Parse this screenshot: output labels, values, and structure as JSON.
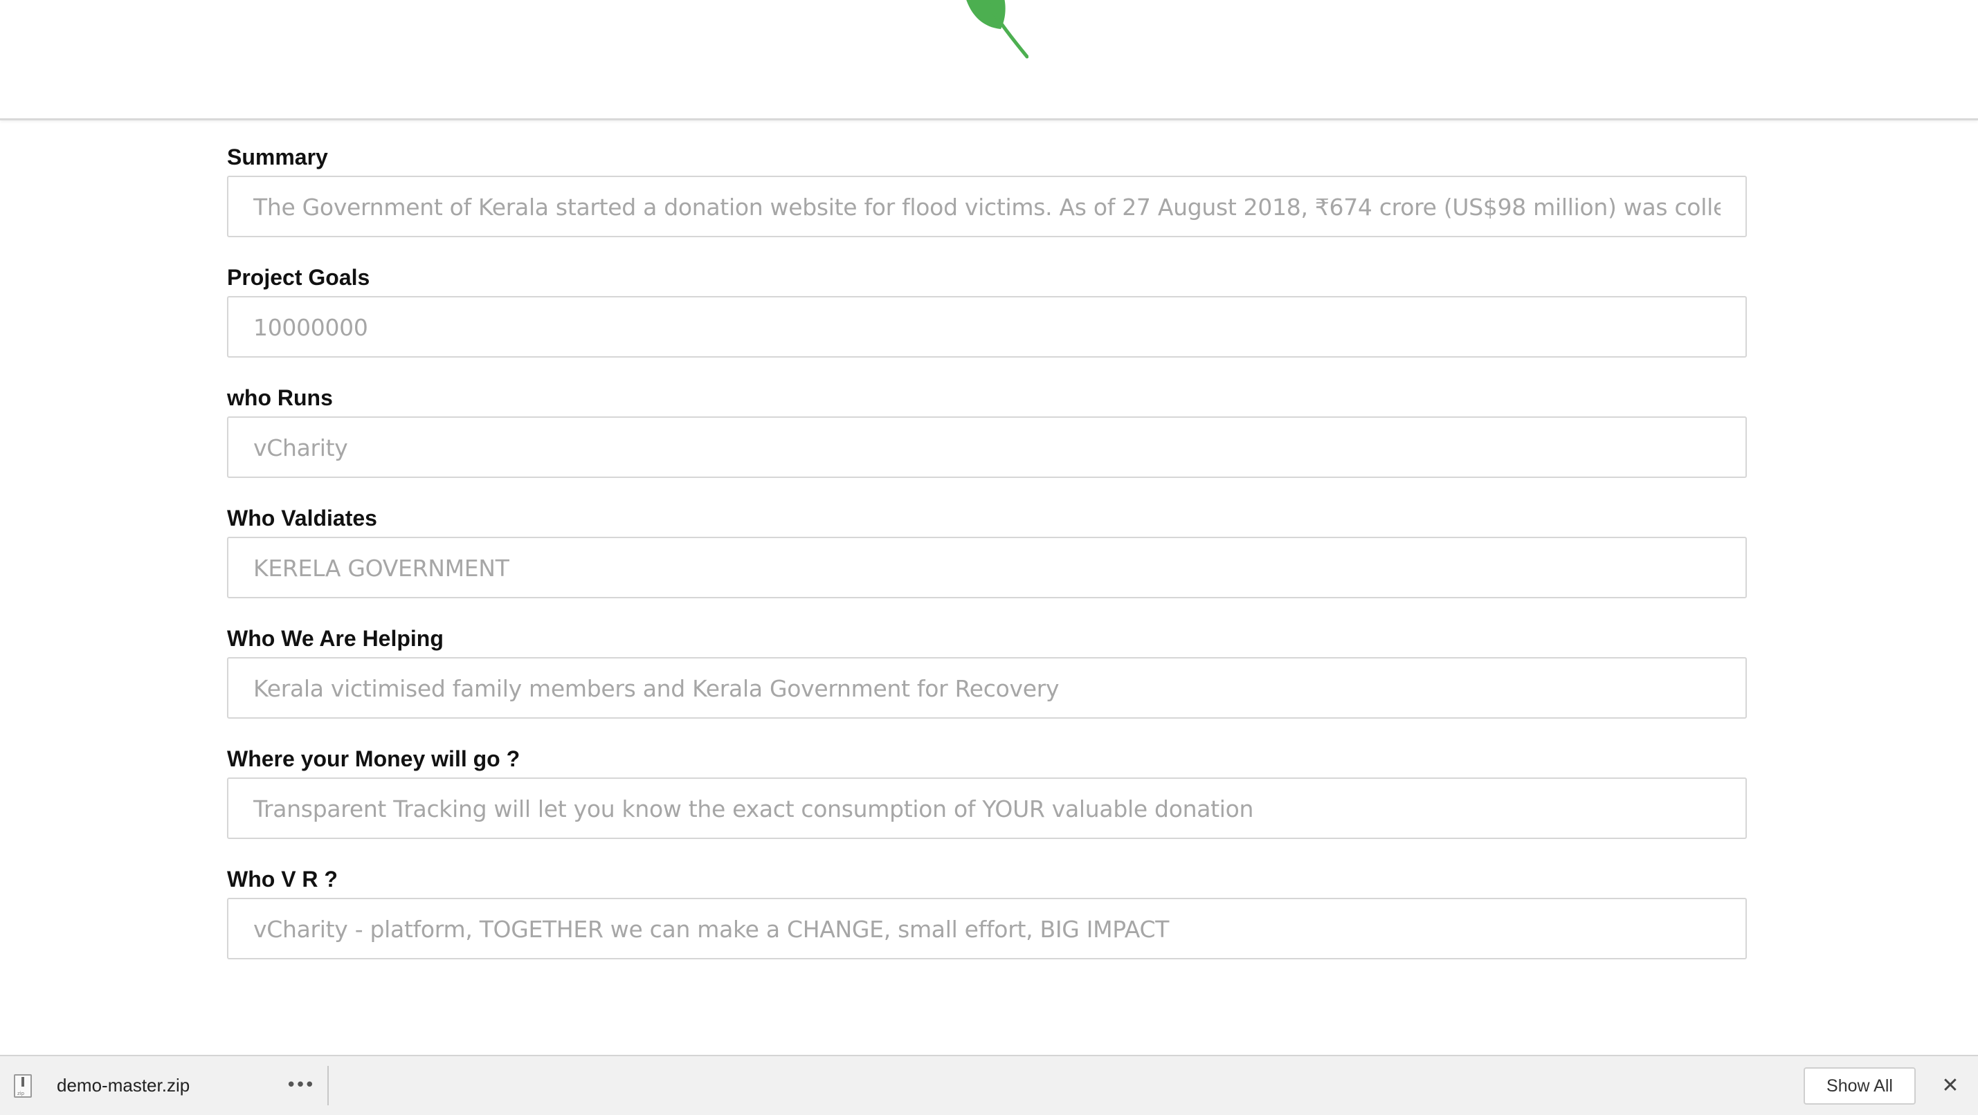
{
  "brand": {
    "logo_icon": "leaf-icon",
    "accent_color": "#4caf50"
  },
  "form": {
    "fields": [
      {
        "label": "Summary",
        "value": "The Government of Kerala started a donation website for flood victims. As of 27 August 2018, ₹674 crore (US$98 million) was collected from th"
      },
      {
        "label": "Project Goals",
        "value": "10000000"
      },
      {
        "label": "who Runs",
        "value": "vCharity"
      },
      {
        "label": "Who Valdiates",
        "value": "KERELA GOVERNMENT"
      },
      {
        "label": "Who We Are Helping",
        "value": "Kerala victimised family members and Kerala Government for Recovery"
      },
      {
        "label": "Where your Money will go ?",
        "value": "Transparent Tracking will let you know the exact consumption of YOUR valuable donation"
      },
      {
        "label": "Who V R ?",
        "value": "vCharity - platform, TOGETHER we can make a CHANGE, small effort, BIG IMPACT"
      }
    ]
  },
  "download_bar": {
    "file_icon": "zip-file-icon",
    "file_name": "demo-master.zip",
    "more_icon": "ellipsis-icon",
    "more_label": "•••",
    "show_all_label": "Show All",
    "close_icon": "close-icon",
    "close_label": "✕"
  }
}
